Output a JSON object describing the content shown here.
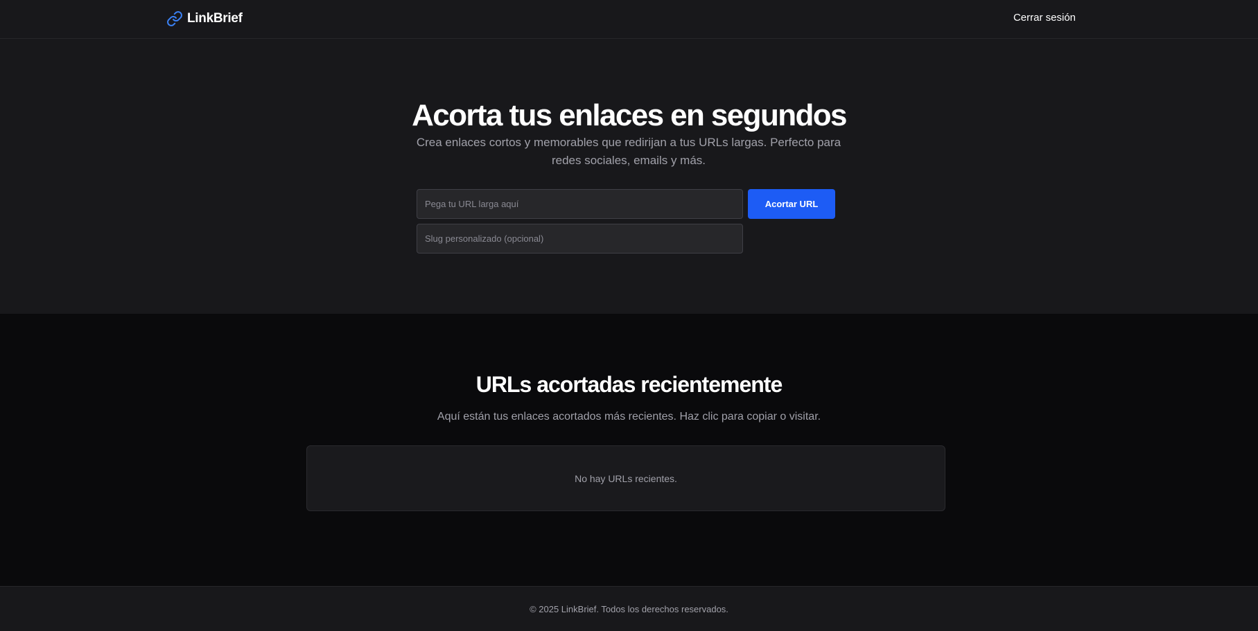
{
  "header": {
    "brand_name": "LinkBrief",
    "brand_icon": "link-icon",
    "logout_label": "Cerrar sesión"
  },
  "hero": {
    "title": "Acorta tus enlaces en segundos",
    "subtitle": "Crea enlaces cortos y memorables que redirijan a tus URLs largas. Perfecto para redes sociales, emails y más.",
    "url_input": {
      "value": "",
      "placeholder": "Pega tu URL larga aquí"
    },
    "slug_input": {
      "value": "",
      "placeholder": "Slug personalizado (opcional)"
    },
    "shorten_label": "Acortar URL"
  },
  "recent": {
    "title": "URLs acortadas recientemente",
    "subtitle": "Aquí están tus enlaces acortados más recientes. Haz clic para copiar o visitar.",
    "empty_message": "No hay URLs recientes."
  },
  "footer": {
    "text": "© 2025 LinkBrief. Todos los derechos reservados."
  },
  "colors": {
    "accent": "#1d5cf5",
    "brand_icon": "#3b82f6",
    "surface": "#18181b",
    "background": "#0a0a0c"
  }
}
